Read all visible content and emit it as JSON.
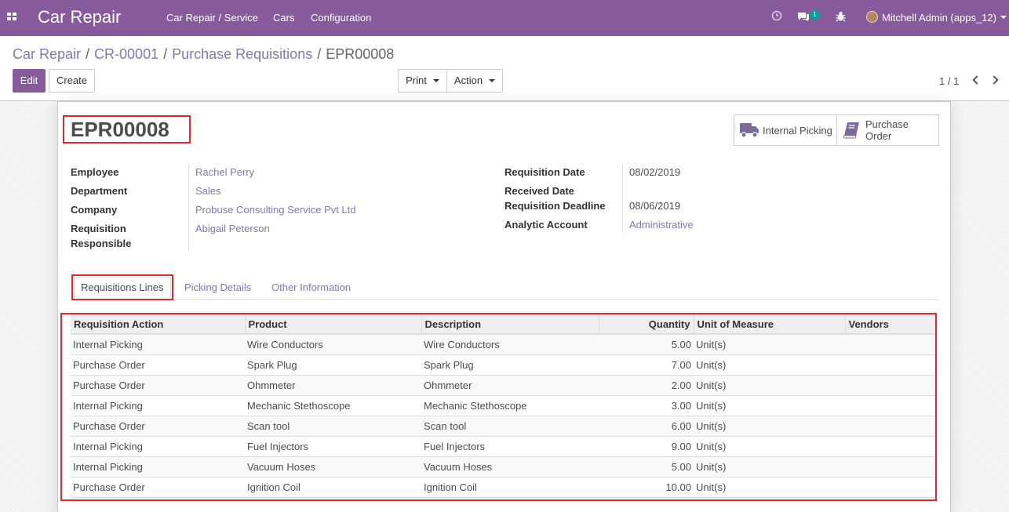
{
  "topbar": {
    "app_title": "Car Repair",
    "menu": [
      "Car Repair / Service",
      "Cars",
      "Configuration"
    ],
    "messages_count": "1",
    "user_name": "Mitchell Admin (apps_12)",
    "bar_color": "#875a9b"
  },
  "breadcrumb": {
    "items": [
      "Car Repair",
      "CR-00001",
      "Purchase Requisitions"
    ],
    "current": "EPR00008"
  },
  "toolbar": {
    "edit_label": "Edit",
    "create_label": "Create",
    "print_label": "Print",
    "action_label": "Action",
    "pager": "1 / 1"
  },
  "record": {
    "name": "EPR00008",
    "smart_buttons": {
      "internal_picking": "Internal Picking",
      "purchase_order_line1": "Purchase",
      "purchase_order_line2": "Order"
    },
    "left_fields": {
      "employee_label": "Employee",
      "employee": "Rachel Perry",
      "department_label": "Department",
      "department": "Sales",
      "company_label": "Company",
      "company": "Probuse Consulting Service Pvt Ltd",
      "responsible_label_1": "Requisition",
      "responsible_label_2": "Responsible",
      "responsible": "Abigail Peterson"
    },
    "right_fields": {
      "req_date_label": "Requisition Date",
      "req_date": "08/02/2019",
      "received_label": "Received Date",
      "received": "",
      "deadline_label": "Requisition Deadline",
      "deadline": "08/06/2019",
      "analytic_label": "Analytic Account",
      "analytic": "Administrative"
    }
  },
  "tabs": [
    "Requisitions Lines",
    "Picking Details",
    "Other Information"
  ],
  "lines": {
    "headers": [
      "Requisition Action",
      "Product",
      "Description",
      "Quantity",
      "Unit of Measure",
      "Vendors"
    ],
    "rows": [
      [
        "Internal Picking",
        "Wire Conductors",
        "Wire Conductors",
        "5.00",
        "Unit(s)",
        ""
      ],
      [
        "Purchase Order",
        "Spark Plug",
        "Spark Plug",
        "7.00",
        "Unit(s)",
        ""
      ],
      [
        "Purchase Order",
        "Ohmmeter",
        "Ohmmeter",
        "2.00",
        "Unit(s)",
        ""
      ],
      [
        "Internal Picking",
        "Mechanic Stethoscope",
        "Mechanic Stethoscope",
        "3.00",
        "Unit(s)",
        ""
      ],
      [
        "Purchase Order",
        "Scan tool",
        "Scan tool",
        "6.00",
        "Unit(s)",
        ""
      ],
      [
        "Internal Picking",
        "Fuel Injectors",
        "Fuel Injectors",
        "9.00",
        "Unit(s)",
        ""
      ],
      [
        "Internal Picking",
        "Vacuum Hoses",
        "Vacuum Hoses",
        "5.00",
        "Unit(s)",
        ""
      ],
      [
        "Purchase Order",
        "Ignition Coil",
        "Ignition Coil",
        "10.00",
        "Unit(s)",
        ""
      ]
    ]
  },
  "highlight_color": "#e0262f",
  "link_color": "#7c7bad"
}
